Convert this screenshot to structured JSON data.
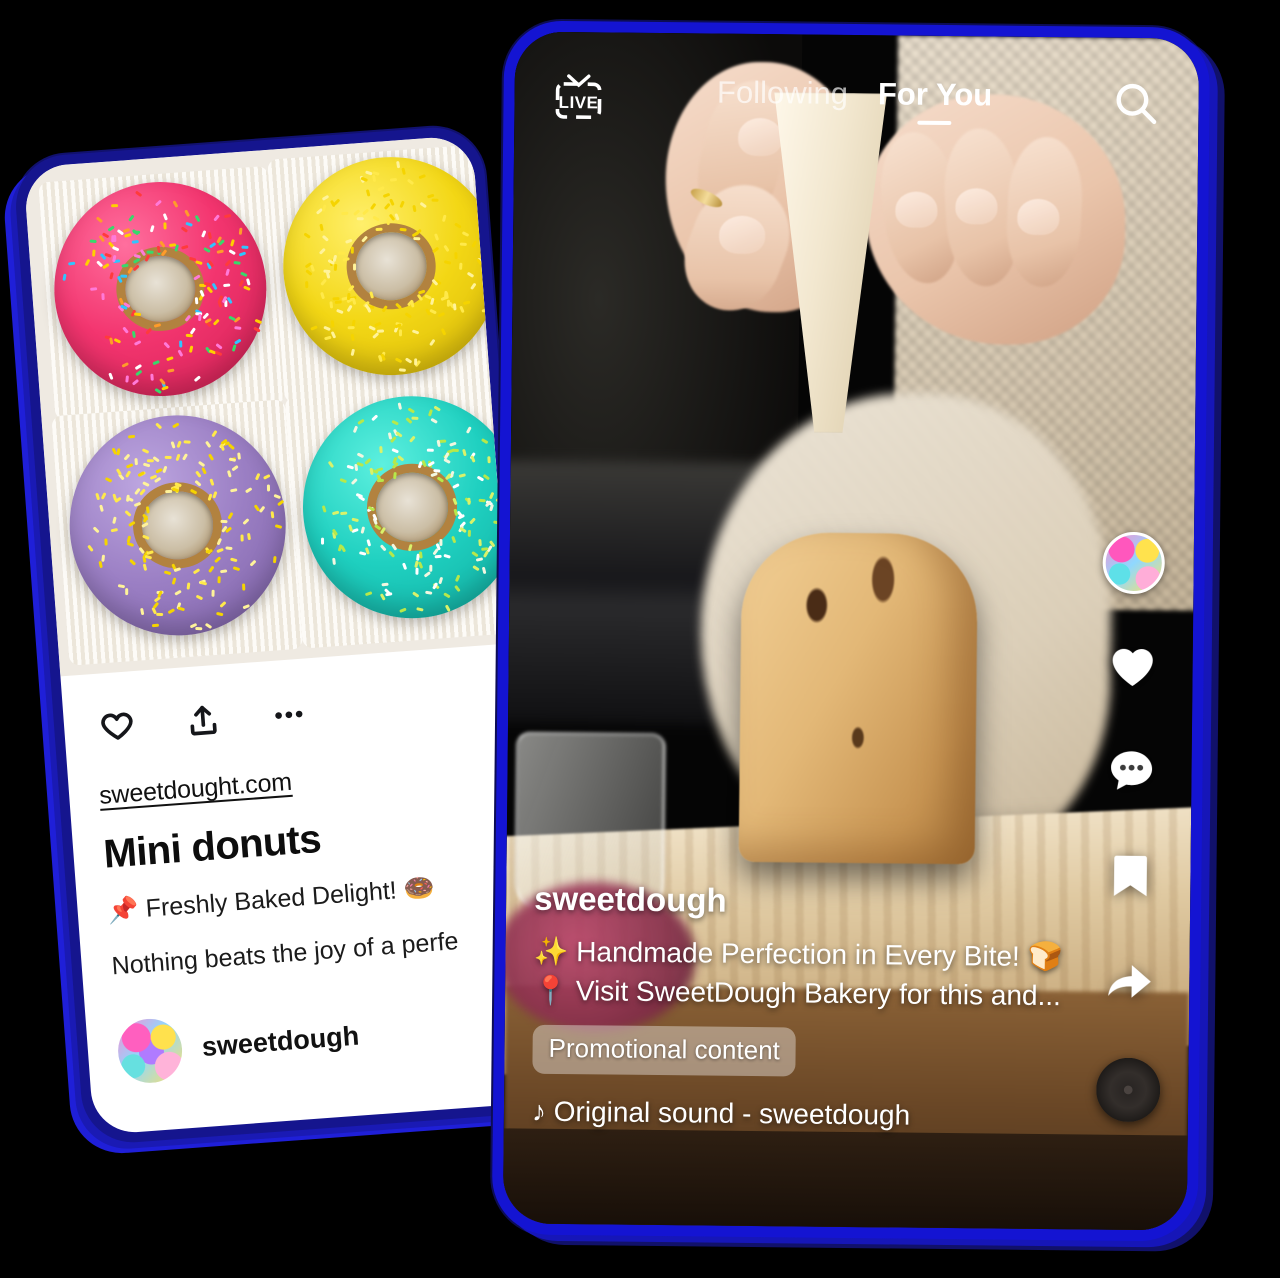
{
  "left_phone": {
    "post_image_alt": "four-mini-donuts-with-sprinkles",
    "actions": {
      "like_label": "like",
      "share_label": "share",
      "more_label": "more options"
    },
    "site_link": "sweetdought.com",
    "title": "Mini donuts",
    "subtitle": "📌 Freshly Baked Delight! 🍩",
    "body": "Nothing beats the joy of a perfe",
    "user": "sweetdough",
    "donuts": [
      {
        "name": "pink-donut",
        "glaze": "#f3356f",
        "sprinkles": "rainbow"
      },
      {
        "name": "yellow-donut",
        "glaze": "#f3d715",
        "sprinkles": "yellow"
      },
      {
        "name": "purple-donut",
        "glaze": "#9b7fc4",
        "sprinkles": "yellow"
      },
      {
        "name": "teal-donut",
        "glaze": "#1fd0c0",
        "sprinkles": "white-green"
      }
    ]
  },
  "right_phone": {
    "topbar": {
      "live_label": "LIVE",
      "tab_following": "Following",
      "tab_for_you": "For You",
      "active_tab": "For You",
      "search_label": "Search"
    },
    "video_alt": "hands-piping-cream-over-chocolate-chip-panettone-on-wooden-board",
    "caption": {
      "username": "sweetdough",
      "line1": "✨ Handmade Perfection in Every Bite! 🍞",
      "line2": "📍 Visit SweetDough Bakery for this and...",
      "promo_badge": "Promotional content",
      "sound": "♪ Original sound - sweetdough"
    },
    "rail": {
      "avatar_label": "sweetdough profile",
      "like_label": "like",
      "comment_label": "comments",
      "bookmark_label": "save",
      "share_label": "share",
      "disc_label": "sound disc"
    }
  },
  "theme": {
    "bezel_blue": "#1414d2",
    "bezel_navy": "#15158e",
    "background": "#000000",
    "card_bg": "#ffffff"
  }
}
